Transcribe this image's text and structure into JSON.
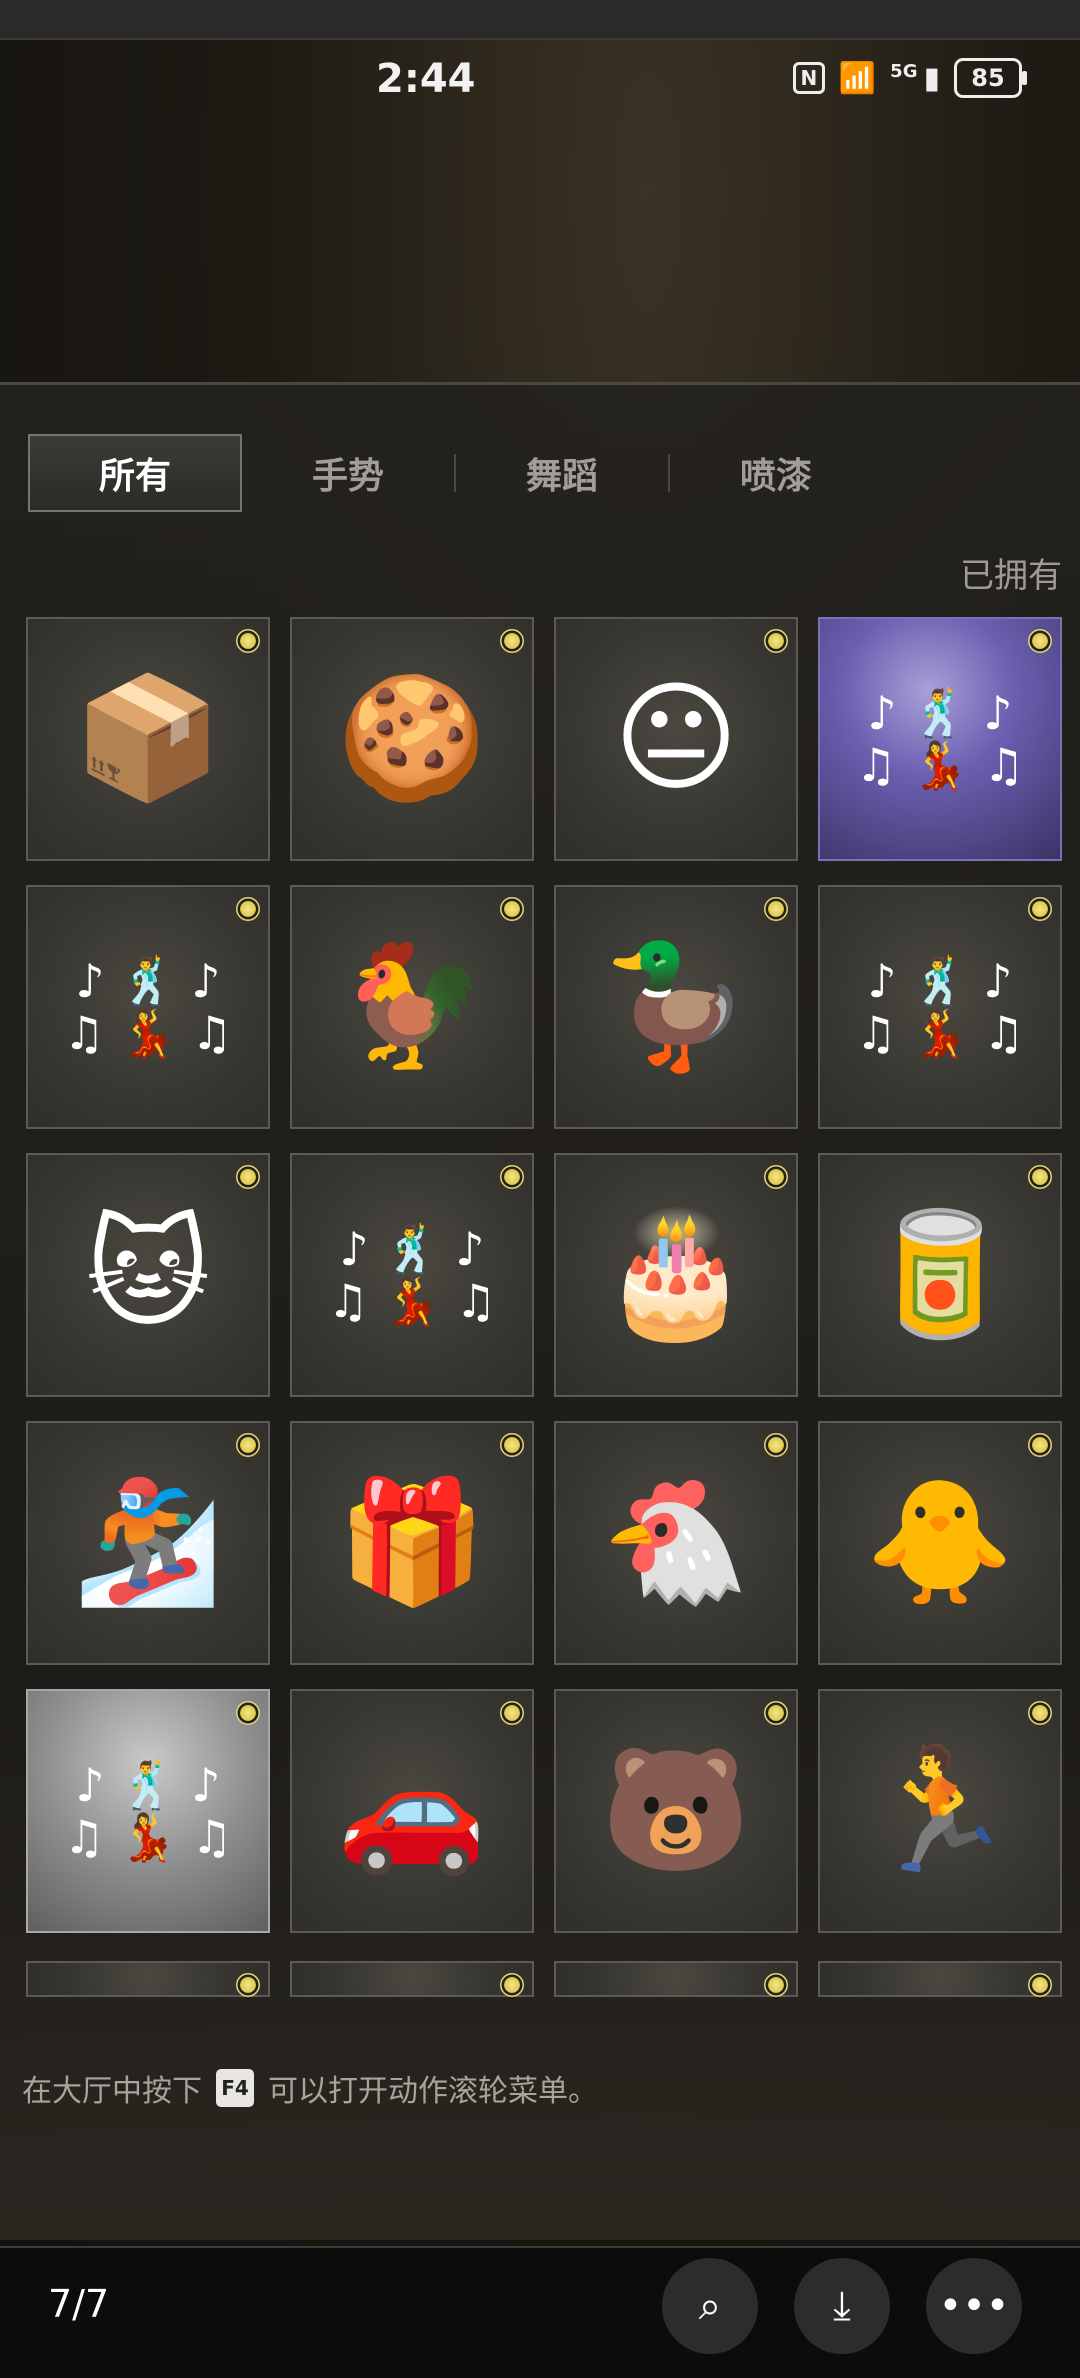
{
  "status_bar": {
    "time": "2:44",
    "nfc_icon": "nfc-icon",
    "wifi_icon": "wifi-icon",
    "network": "5G",
    "battery": "85"
  },
  "tabs": [
    {
      "label": "所有",
      "active": true
    },
    {
      "label": "手势",
      "active": false
    },
    {
      "label": "舞蹈",
      "active": false
    },
    {
      "label": "喷漆",
      "active": false
    }
  ],
  "owned_label": "已拥有",
  "grid_items": [
    {
      "name": "laptop-case-spray",
      "icon": "📦",
      "style": "normal"
    },
    {
      "name": "grenade-cookie-spray",
      "icon": "🍪",
      "style": "normal"
    },
    {
      "name": "sketch-face-spray",
      "icon": "😐",
      "style": "normal"
    },
    {
      "name": "group-dance-emote",
      "icon": "dance-icon",
      "style": "purple"
    },
    {
      "name": "duo-dance-emote",
      "icon": "dance-icon",
      "style": "normal"
    },
    {
      "name": "rooster-jacket-spray",
      "icon": "🐓",
      "style": "normal"
    },
    {
      "name": "helmet-duck-spray",
      "icon": "🦆",
      "style": "normal"
    },
    {
      "name": "duo-dance-emote-2",
      "icon": "dance-icon",
      "style": "normal"
    },
    {
      "name": "party-cat-spray",
      "icon": "🐱",
      "style": "normal"
    },
    {
      "name": "kick-dance-emote",
      "icon": "dance-icon",
      "style": "normal"
    },
    {
      "name": "anniversary-cake-spray",
      "icon": "🎂",
      "style": "normal"
    },
    {
      "name": "worms-can-spray",
      "icon": "🥫",
      "style": "normal"
    },
    {
      "name": "battle-sticker-spray",
      "icon": "🏂",
      "style": "normal"
    },
    {
      "name": "crate-mascot-spray",
      "icon": "🎁",
      "style": "normal"
    },
    {
      "name": "no-dinner-chef-spray",
      "icon": "🐔",
      "style": "normal"
    },
    {
      "name": "rubber-chicken-spray",
      "icon": "🐥",
      "style": "normal"
    },
    {
      "name": "solo-dance-emote",
      "icon": "dance-icon",
      "style": "silver"
    },
    {
      "name": "wrecked-car-spray",
      "icon": "🚗",
      "style": "normal"
    },
    {
      "name": "animal-faces-spray",
      "icon": "🐻",
      "style": "normal"
    },
    {
      "name": "running-soldier-spray",
      "icon": "🏃",
      "style": "normal"
    },
    {
      "name": "partial-item-1",
      "icon": "",
      "style": "partial"
    },
    {
      "name": "partial-item-2",
      "icon": "",
      "style": "partial"
    },
    {
      "name": "partial-item-3",
      "icon": "",
      "style": "partial"
    },
    {
      "name": "partial-item-4",
      "icon": "",
      "style": "partial"
    }
  ],
  "hint": {
    "before": "在大厅中按下",
    "key": "F4",
    "after": "可以打开动作滚轮菜单。"
  },
  "viewer": {
    "page_count": "7/7",
    "lens_icon": "image-search-icon",
    "download_icon": "download-icon",
    "more_icon": "more-icon"
  }
}
